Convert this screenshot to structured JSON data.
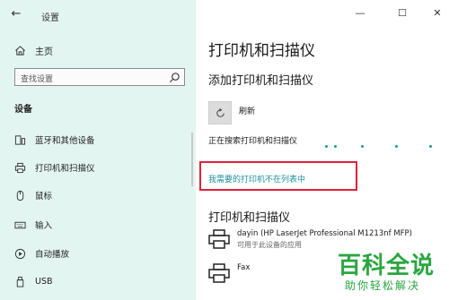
{
  "window": {
    "title": "设置",
    "back_icon": "back-arrow-icon",
    "minimize_glyph": "—",
    "maximize_glyph": "☐",
    "close_glyph": "✕"
  },
  "sidebar": {
    "home_label": "主页",
    "search_placeholder": "查找设置",
    "section_heading": "设备",
    "items": [
      {
        "label": "蓝牙和其他设备",
        "icon": "bluetooth-devices-icon"
      },
      {
        "label": "打印机和扫描仪",
        "icon": "printer-icon",
        "active": true
      },
      {
        "label": "鼠标",
        "icon": "mouse-icon"
      },
      {
        "label": "输入",
        "icon": "keyboard-icon"
      },
      {
        "label": "自动播放",
        "icon": "autoplay-icon"
      },
      {
        "label": "USB",
        "icon": "usb-icon"
      }
    ]
  },
  "main": {
    "page_title": "打印机和扫描仪",
    "add_section_title": "添加打印机和扫描仪",
    "refresh_label": "刷新",
    "searching_text": "正在搜索打印机和扫描仪",
    "not_listed_link": "我需要的打印机不在列表中",
    "printers_heading": "打印机和扫描仪",
    "printers": [
      {
        "name": "dayin (HP LaserJet Professional M1213nf MFP)",
        "status": "可用于此设备的应用"
      },
      {
        "name": "Fax",
        "status": ""
      }
    ]
  },
  "colors": {
    "sidebar_bg": "#e3f5f1",
    "link": "#1d8fa0",
    "highlight_border": "#e0213a",
    "watermark_green": "#2aa640"
  },
  "watermark": {
    "brand": "百科全说",
    "tagline": "助你轻松解决"
  }
}
